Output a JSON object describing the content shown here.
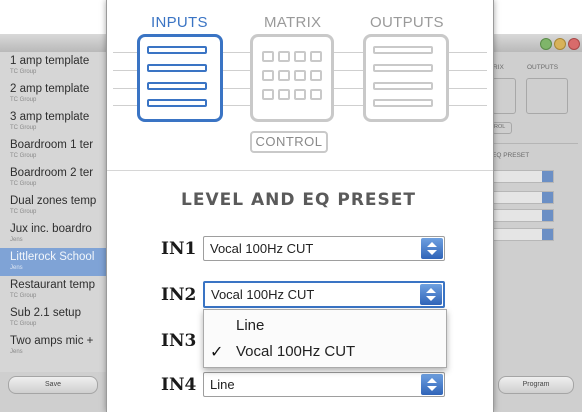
{
  "background_window": {
    "templates": [
      {
        "name": "1 amp template",
        "group": "TC Group"
      },
      {
        "name": "2 amp template",
        "group": "TC Group"
      },
      {
        "name": "3 amp template",
        "group": "TC Group"
      },
      {
        "name": "Boardroom 1 ter",
        "group": "TC Group"
      },
      {
        "name": "Boardroom 2 ter",
        "group": "TC Group"
      },
      {
        "name": "Dual zones temp",
        "group": "TC Group"
      },
      {
        "name": "Jux inc. boardro",
        "group": "Jens"
      },
      {
        "name": "Littlerock School",
        "group": "Jens",
        "selected": true
      },
      {
        "name": "Restaurant temp",
        "group": "TC Group"
      },
      {
        "name": "Sub 2.1 setup",
        "group": "TC Group"
      },
      {
        "name": "Two amps mic +",
        "group": "Jens"
      }
    ],
    "save_label": "Save",
    "program_label": "Program",
    "right_labels": {
      "matrix": "RIX",
      "outputs": "OUTPUTS",
      "control": "ROL",
      "eq_preset": "EQ PRESET"
    }
  },
  "tabs": {
    "inputs": "INPUTS",
    "matrix": "MATRIX",
    "outputs": "OUTPUTS",
    "control": "CONTROL",
    "active": "inputs"
  },
  "section_title": "LEVEL AND EQ PRESET",
  "inputs": [
    {
      "label": "IN1",
      "value": "Vocal 100Hz CUT"
    },
    {
      "label": "IN2",
      "value": "Vocal 100Hz CUT"
    },
    {
      "label": "IN3",
      "value": ""
    },
    {
      "label": "IN4",
      "value": "Line"
    }
  ],
  "dropdown": {
    "options": [
      {
        "label": "Line",
        "checked": false
      },
      {
        "label": "Vocal 100Hz CUT",
        "checked": true
      }
    ],
    "check_glyph": "✓"
  },
  "colors": {
    "accent": "#3a74c4",
    "inactive": "#c9c9c9",
    "selected_row": "#7fa3d6"
  }
}
